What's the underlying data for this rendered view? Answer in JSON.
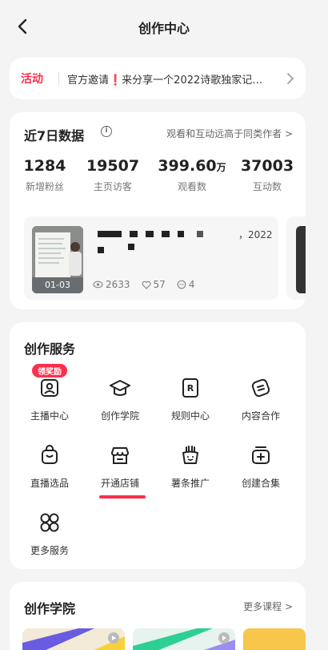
{
  "header": {
    "title": "创作中心",
    "back_icon": "chevron-left-icon"
  },
  "activity": {
    "tag": "活动",
    "text": "官方邀请❗️来分享一个2022诗歌独家记…",
    "arrow_icon": "chevron-right-icon"
  },
  "stats": {
    "title": "近7日数据",
    "info_icon": "info-icon",
    "link": "观看和互动远高于同类作者 >",
    "items": [
      {
        "value": "1284",
        "unit": "",
        "label": "新增粉丝"
      },
      {
        "value": "19507",
        "unit": "",
        "label": "主页访客"
      },
      {
        "value": "399.60",
        "unit": "万",
        "label": "观看数"
      },
      {
        "value": "37003",
        "unit": "",
        "label": "互动数"
      }
    ],
    "post": {
      "date": "01-03",
      "title_suffix": "，2022",
      "views": "2633",
      "likes": "57",
      "comments": "4"
    }
  },
  "services": {
    "title": "创作服务",
    "badge": "领奖励",
    "items": [
      {
        "label": "主播中心",
        "icon": "user-badge-icon"
      },
      {
        "label": "创作学院",
        "icon": "graduation-cap-icon"
      },
      {
        "label": "规则中心",
        "icon": "rules-book-icon"
      },
      {
        "label": "内容合作",
        "icon": "handshake-icon"
      },
      {
        "label": "直播选品",
        "icon": "shopping-bag-icon"
      },
      {
        "label": "开通店铺",
        "icon": "store-icon"
      },
      {
        "label": "薯条推广",
        "icon": "fries-icon"
      },
      {
        "label": "创建合集",
        "icon": "collection-add-icon"
      },
      {
        "label": "更多服务",
        "icon": "grid-more-icon"
      }
    ]
  },
  "academy": {
    "title": "创作学院",
    "link": "更多课程 >"
  },
  "colors": {
    "accent": "#ff2e4d",
    "background": "#f4f4f4",
    "card": "#ffffff"
  }
}
